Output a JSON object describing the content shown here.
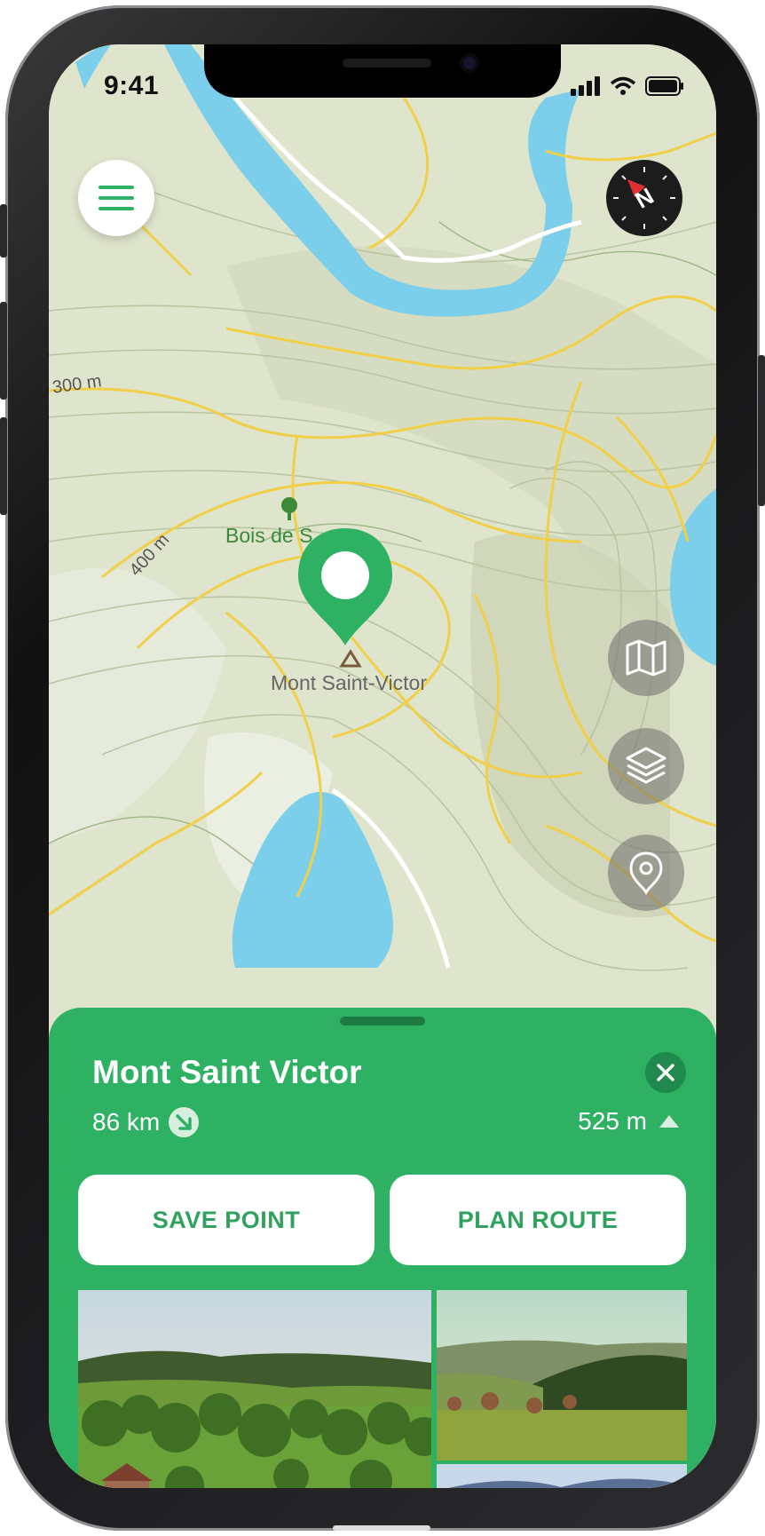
{
  "status_bar": {
    "time": "9:41"
  },
  "map": {
    "labels": {
      "contour_300": "300 m",
      "contour_400": "400 m",
      "forest": "Bois de S",
      "summit": "Mont Saint-Victor"
    },
    "colors": {
      "land": "#dfe5cc",
      "water": "#7ccfeb",
      "roads": "#f1cf48",
      "pin": "#2fb163"
    }
  },
  "controls": {
    "menu_icon": "hamburger-icon",
    "compass_icon": "compass-icon",
    "map_type_icon": "map-icon",
    "layers_icon": "layers-icon",
    "locate_icon": "location-pin-icon"
  },
  "poi_sheet": {
    "title": "Mont Saint Victor",
    "distance": "86 km",
    "direction_icon": "arrow-down-right-icon",
    "elevation": "525 m",
    "elevation_icon": "triangle-up-icon",
    "close_icon": "close-icon",
    "save_label": "SAVE POINT",
    "route_label": "PLAN ROUTE",
    "accent": "#2fb163"
  }
}
